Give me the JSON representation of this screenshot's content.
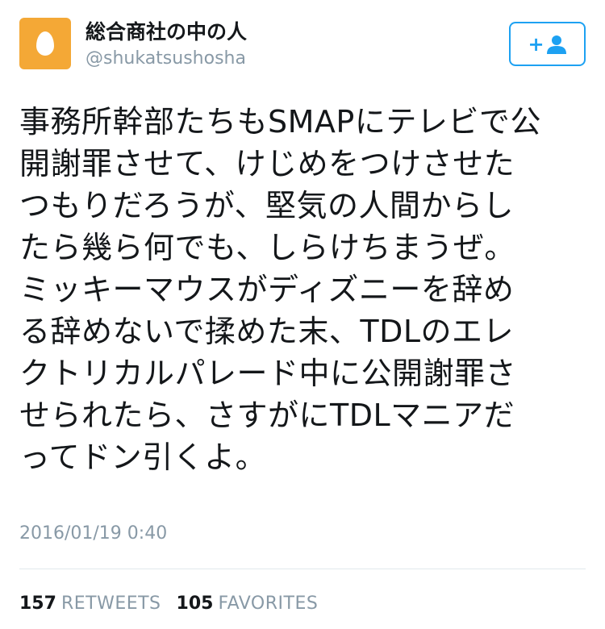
{
  "user": {
    "display_name": "総合商社の中の人",
    "handle": "@shukatsushosha",
    "avatar_icon": "default-egg-avatar",
    "avatar_color": "#f4a836"
  },
  "follow_button": {
    "icon": "follow-user-icon",
    "plus": "+",
    "color": "#1da1f2"
  },
  "tweet": {
    "lines": [
      "事務所幹部たちもSMAPにテレビで公",
      "開謝罪させて、けじめをつけさせた",
      "つもりだろうが、堅気の人間からし",
      "たら幾ら何でも、しらけちまうぜ。",
      "ミッキーマウスがディズニーを辞め",
      "る辞めないで揉めた末、TDLのエレ",
      "クトリカルパレード中に公開謝罪さ",
      "せられたら、さすがにTDLマニアだ",
      "ってドン引くよ。"
    ],
    "timestamp": "2016/01/19 0:40"
  },
  "stats": {
    "retweets_count": "157",
    "retweets_label": "RETWEETS",
    "favorites_count": "105",
    "favorites_label": "FAVORITES"
  }
}
